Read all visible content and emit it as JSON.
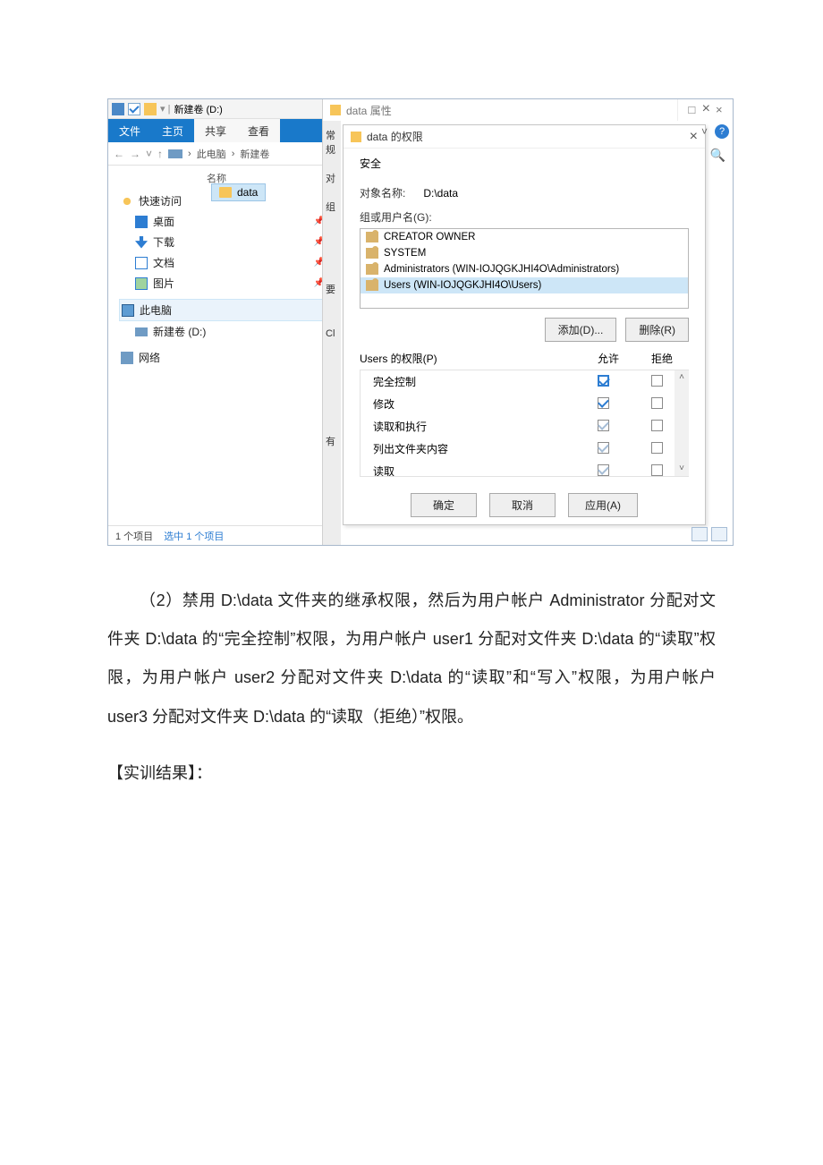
{
  "explorer": {
    "title": "新建卷 (D:)",
    "tabs": {
      "file": "文件",
      "home": "主页",
      "share": "共享",
      "view": "查看"
    },
    "breadcrumb": {
      "thispc": "此电脑",
      "vol": "新建卷"
    },
    "columns": {
      "name": "名称"
    },
    "nav": {
      "quick": "快速访问",
      "desktop": "桌面",
      "downloads": "下载",
      "documents": "文档",
      "pictures": "图片",
      "thispc": "此电脑",
      "volume": "新建卷 (D:)",
      "network": "网络"
    },
    "file_item": "data",
    "status": {
      "count": "1 个项目",
      "selected": "选中 1 个项目"
    }
  },
  "propdlg": {
    "title": "data 属性",
    "sidetabs": {
      "a": "常规",
      "b": "对",
      "c": "组",
      "d": "要",
      "e": "Cl",
      "f": "有"
    }
  },
  "secdlg": {
    "title": "data 的权限",
    "tab": "安全",
    "object_label": "对象名称:",
    "object_value": "D:\\data",
    "groups_label": "组或用户名(G):",
    "groups": {
      "g1": "CREATOR OWNER",
      "g2": "SYSTEM",
      "g3": "Administrators (WIN-IOJQGKJHI4O\\Administrators)",
      "g4": "Users (WIN-IOJQGKJHI4O\\Users)"
    },
    "add_btn": "添加(D)...",
    "remove_btn": "删除(R)",
    "perm_header": "Users 的权限(P)",
    "allow": "允许",
    "deny": "拒绝",
    "perms": {
      "p1": "完全控制",
      "p2": "修改",
      "p3": "读取和执行",
      "p4": "列出文件夹内容",
      "p5": "读取"
    },
    "ok": "确定",
    "cancel": "取消",
    "apply": "应用(A)"
  },
  "doc": {
    "p1": "（2）禁用 D:\\data 文件夹的继承权限，然后为用户帐户 Administrator 分配对文件夹 D:\\data 的“完全控制”权限，为用户帐户 user1 分配对文件夹 D:\\data 的“读取”权限，为用户帐户 user2 分配对文件夹 D:\\data 的“读取”和“写入”权限，为用户帐户 user3 分配对文件夹 D:\\data 的“读取（拒绝）”权限。",
    "p2": "【实训结果】："
  }
}
